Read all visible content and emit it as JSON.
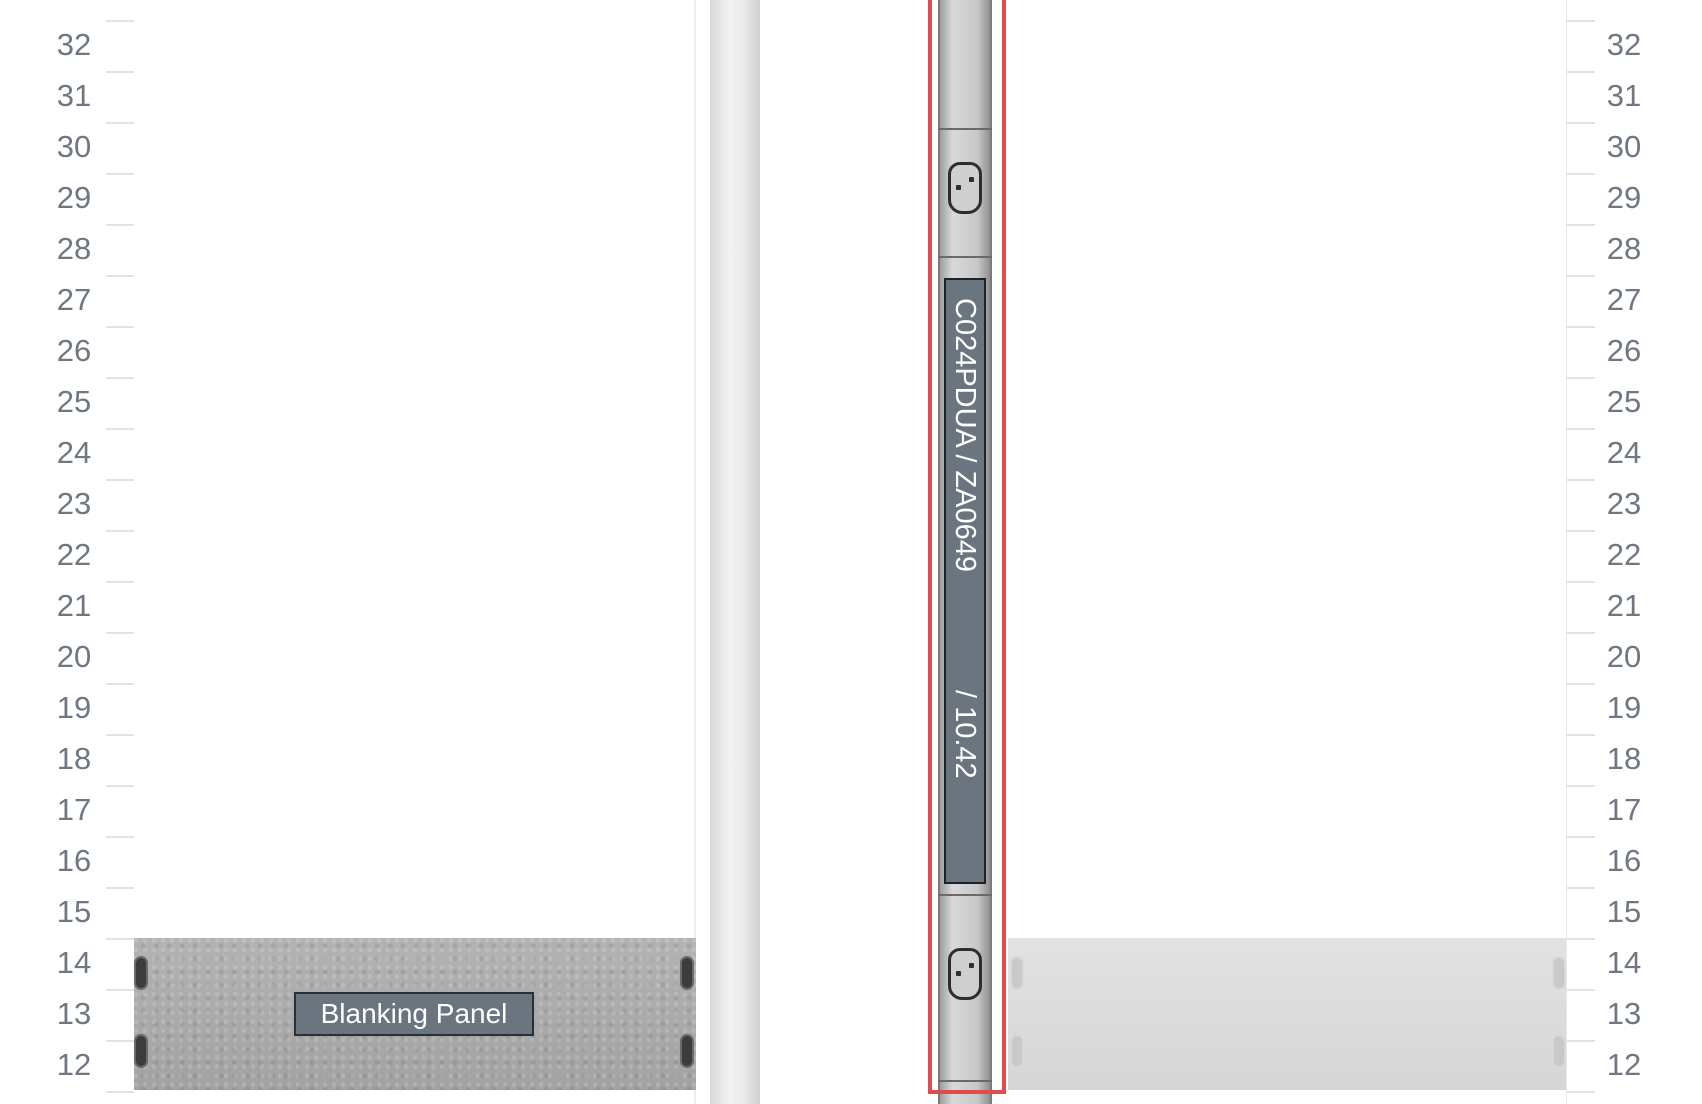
{
  "units": [
    32,
    31,
    30,
    29,
    28,
    27,
    26,
    25,
    24,
    23,
    22,
    21,
    20,
    19,
    18,
    17,
    16,
    15,
    14,
    13,
    12
  ],
  "front_panel": {
    "label": "Blanking Panel"
  },
  "pdu": {
    "name_label": "C024PDUA / ZA0649",
    "ip_label": "/ 10.42",
    "highlight_color": "#e04b50"
  },
  "colors": {
    "unit_text": "#6f7782",
    "label_bg": "#6b7580"
  }
}
